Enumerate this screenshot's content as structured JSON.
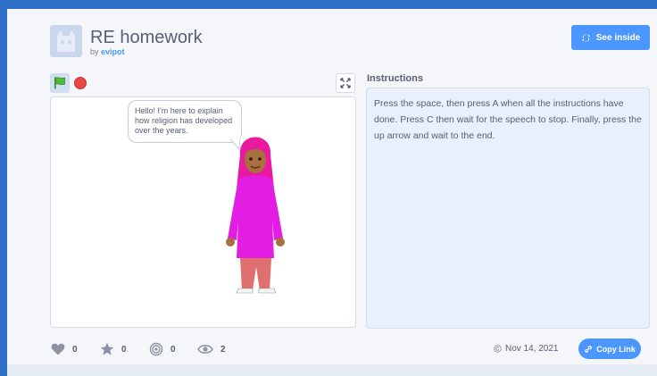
{
  "project": {
    "title": "RE homework",
    "by_prefix": "by",
    "author": "evipot",
    "see_inside_label": "See inside"
  },
  "stage": {
    "speech_text": "Hello! I'm here to explain how religion has developed over the years."
  },
  "instructions": {
    "heading": "Instructions",
    "text": "Press the space, then press A when all the instructions have done. Press C then wait for the speech to stop. Finally, press the up arrow and wait to the end."
  },
  "stats": {
    "loves": "0",
    "favorites": "0",
    "remixes": "0",
    "views": "2"
  },
  "footer": {
    "date": "Nov 14, 2021",
    "copy_link_label": "Copy Link"
  },
  "icons": {
    "flag": "green-flag-icon",
    "stop": "stop-icon",
    "fullscreen": "fullscreen-icon",
    "heart": "heart-icon",
    "star": "star-icon",
    "remix": "remix-icon",
    "views": "eye-icon",
    "copyright": "copyright-icon",
    "link": "link-icon"
  },
  "colors": {
    "accent": "#4c97ff",
    "frame": "#2f6fc9",
    "sprite_hijab": "#e91aa0",
    "sprite_tunic": "#e21ee3",
    "sprite_trousers": "#e07070"
  }
}
